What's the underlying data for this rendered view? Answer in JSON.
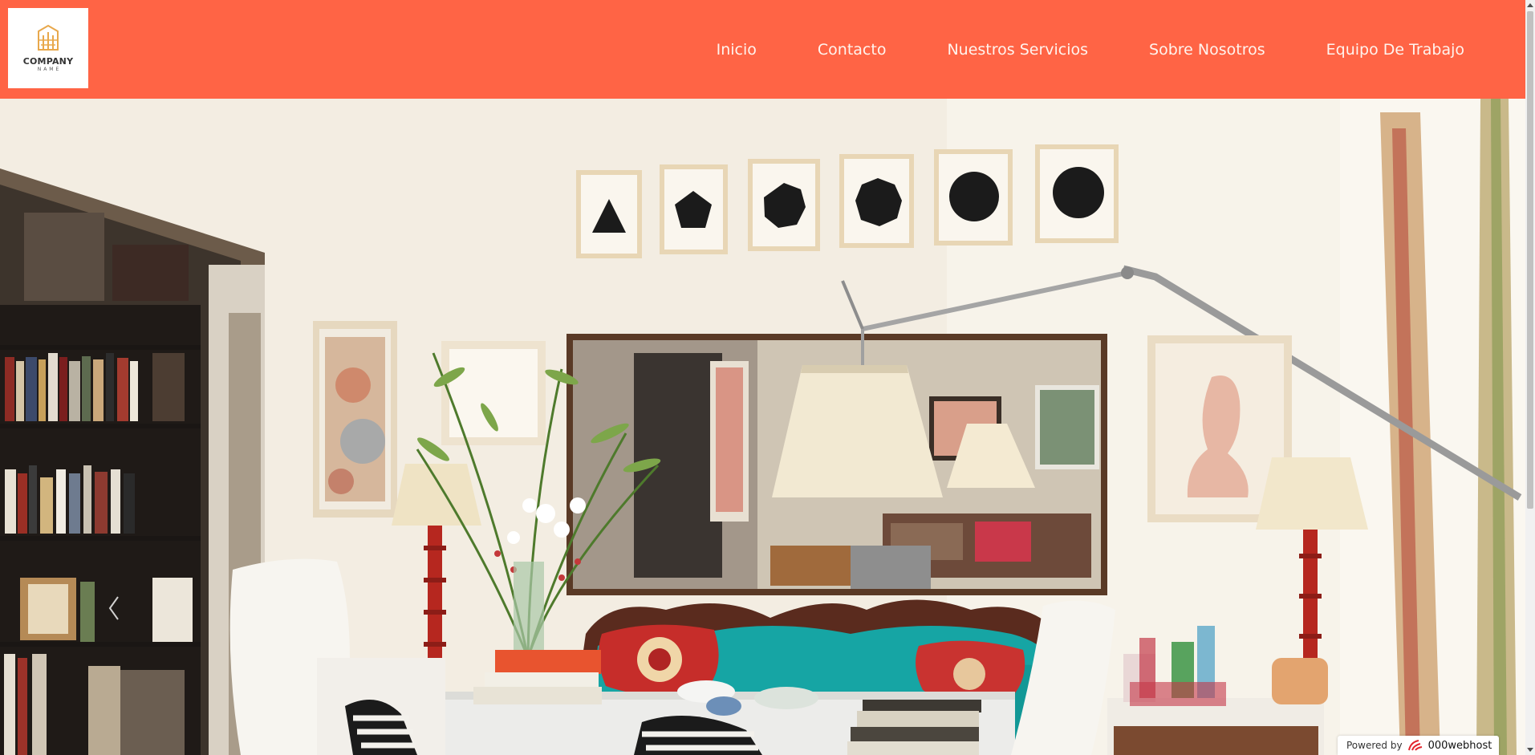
{
  "brand": {
    "logo_title": "COMPANY",
    "logo_subtitle": "NAME",
    "logo_color": "#e8a84c"
  },
  "nav": {
    "items": [
      {
        "label": "Inicio"
      },
      {
        "label": "Contacto"
      },
      {
        "label": "Nuestros Servicios"
      },
      {
        "label": "Sobre Nosotros"
      },
      {
        "label": "Equipo De Trabajo"
      }
    ]
  },
  "colors": {
    "header_bg": "#ff6445",
    "nav_text": "#fff4ee"
  },
  "hero": {
    "icon": "chevron-left-icon"
  },
  "badge": {
    "prefix": "Powered by",
    "brand": "000webhost",
    "icon": "webhost-logo-icon"
  }
}
